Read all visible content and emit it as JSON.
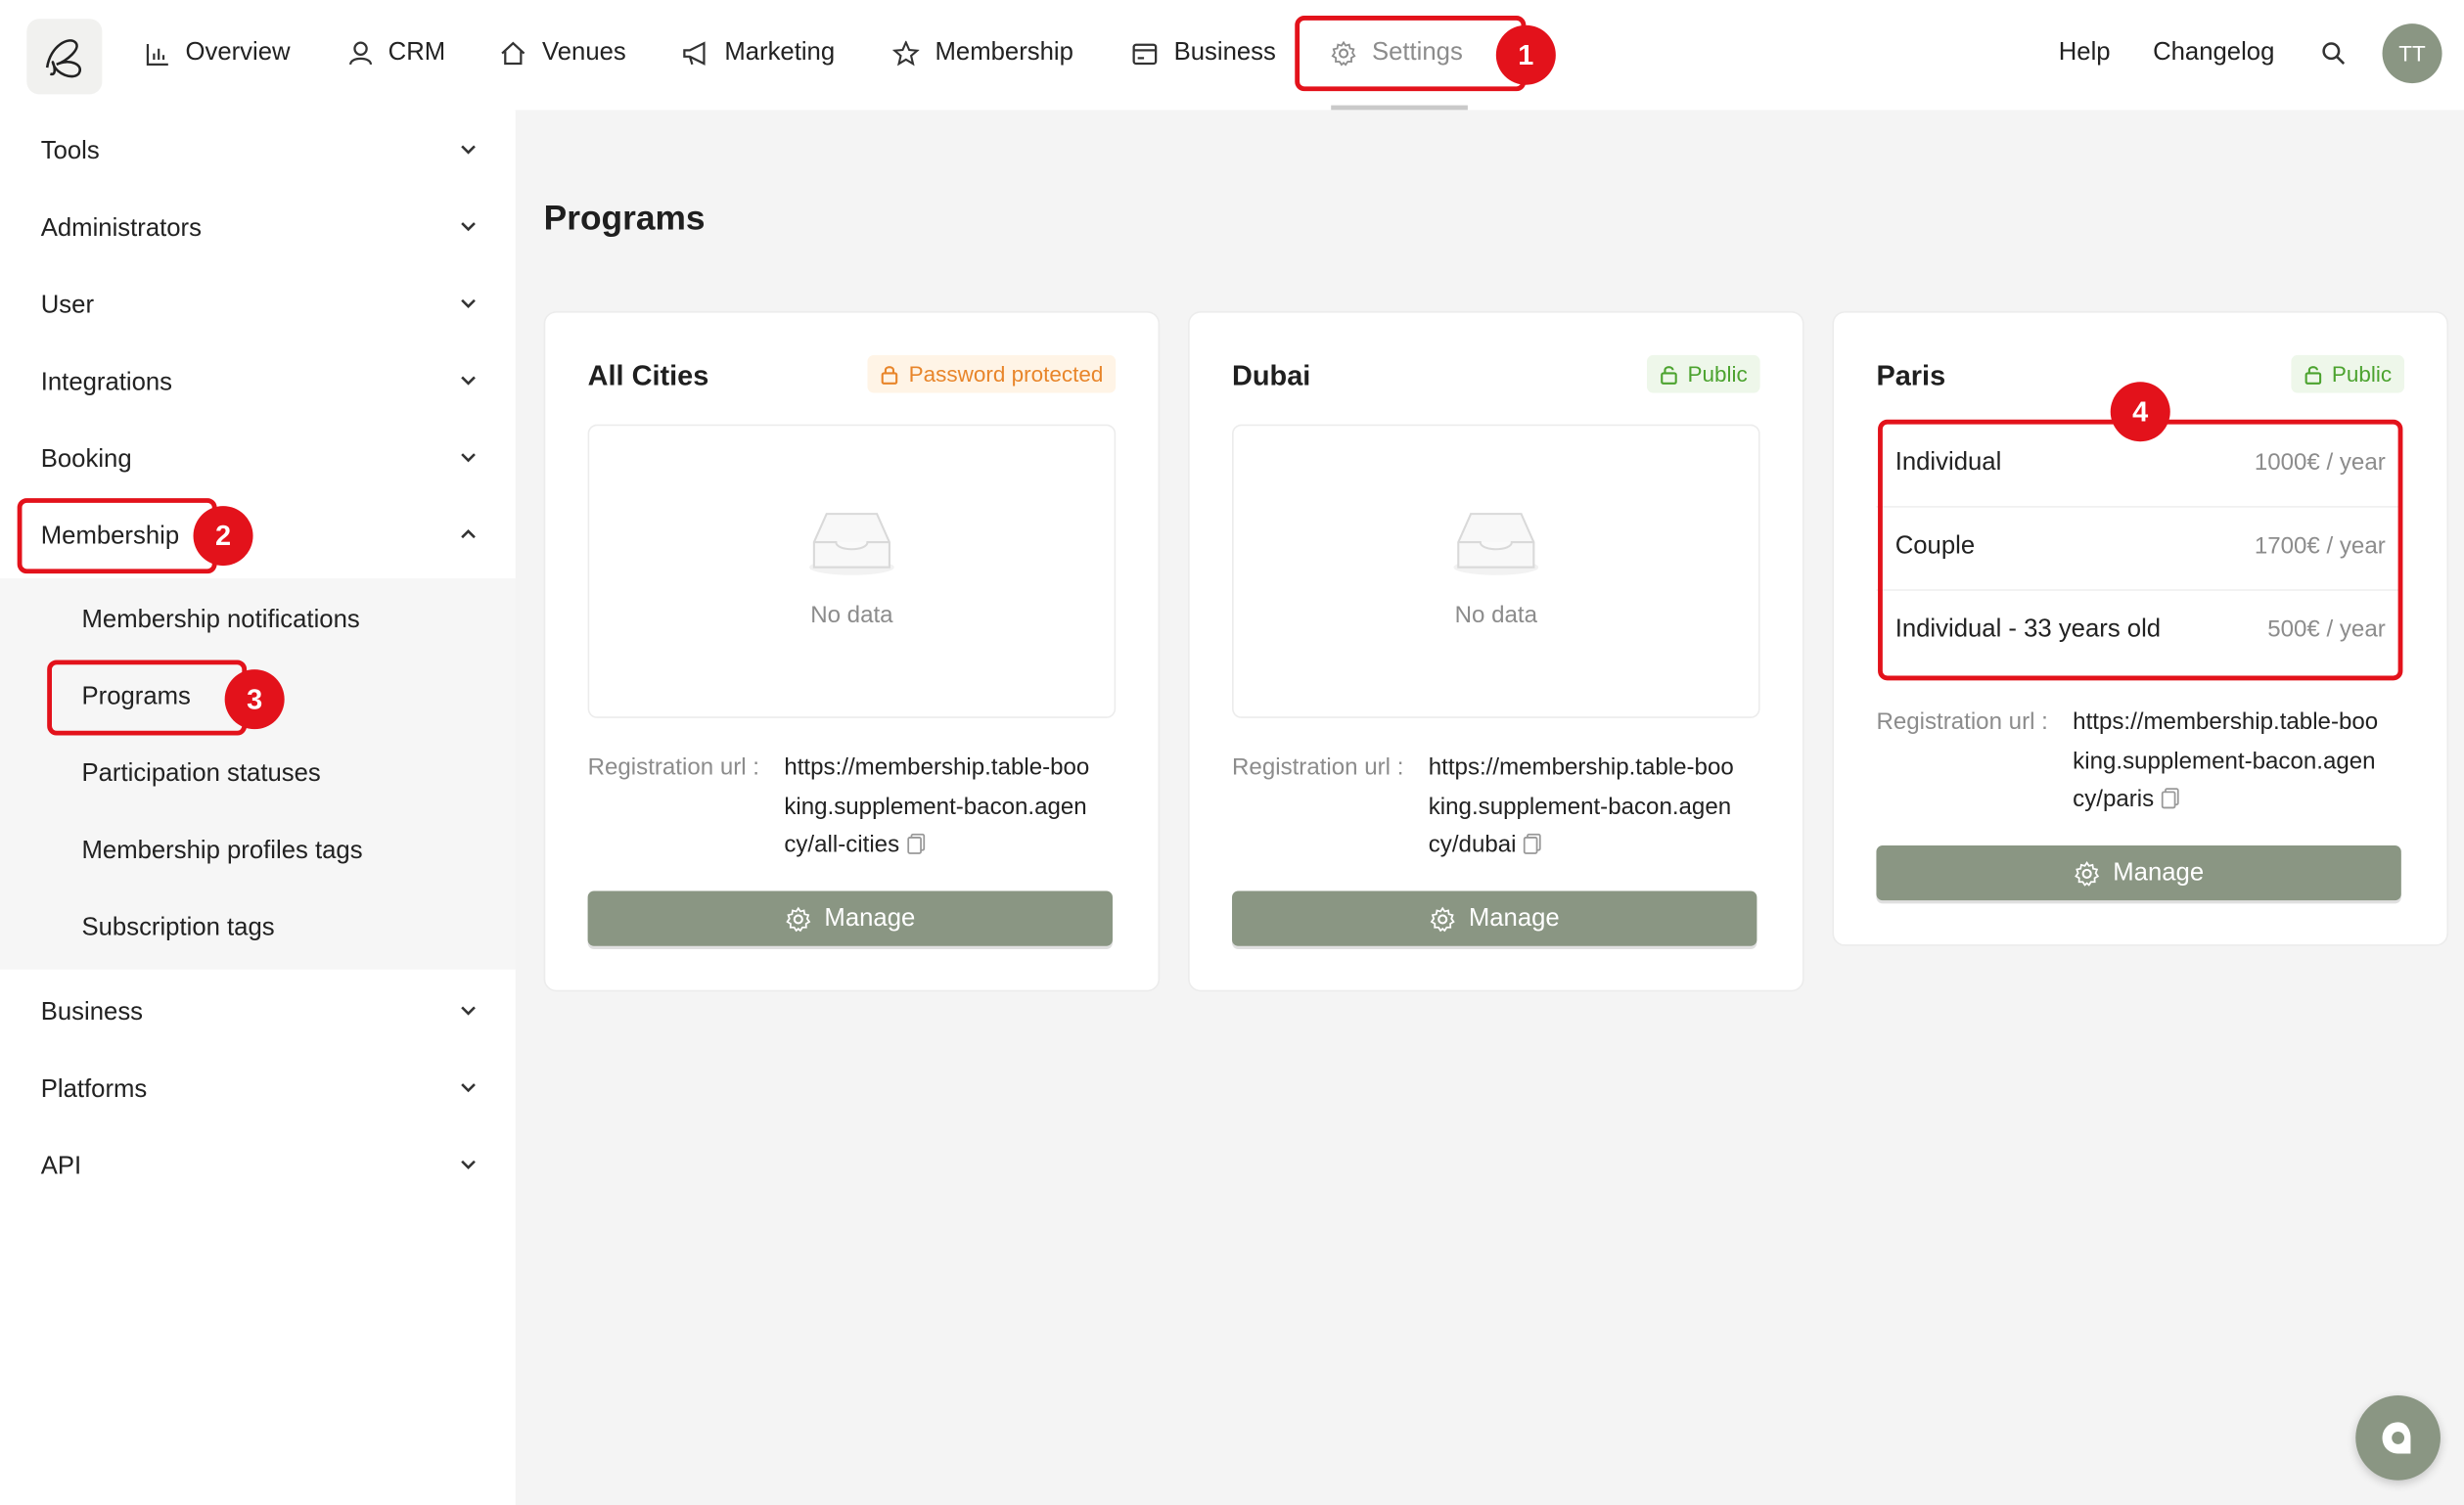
{
  "nav": {
    "items": [
      {
        "label": "Overview",
        "icon": "bar-chart-icon"
      },
      {
        "label": "CRM",
        "icon": "user-icon"
      },
      {
        "label": "Venues",
        "icon": "home-icon"
      },
      {
        "label": "Marketing",
        "icon": "megaphone-icon"
      },
      {
        "label": "Membership",
        "icon": "star-icon"
      },
      {
        "label": "Business",
        "icon": "wallet-icon"
      },
      {
        "label": "Settings",
        "icon": "gear-icon"
      }
    ],
    "active": "Settings",
    "help": "Help",
    "changelog": "Changelog",
    "avatar": "TT"
  },
  "sidebar": {
    "items": [
      {
        "label": "Tools"
      },
      {
        "label": "Administrators"
      },
      {
        "label": "User"
      },
      {
        "label": "Integrations"
      },
      {
        "label": "Booking"
      },
      {
        "label": "Membership"
      },
      {
        "label": "Business"
      },
      {
        "label": "Platforms"
      },
      {
        "label": "API"
      }
    ],
    "membership_sub": [
      {
        "label": "Membership notifications"
      },
      {
        "label": "Programs"
      },
      {
        "label": "Participation statuses"
      },
      {
        "label": "Membership profiles tags"
      },
      {
        "label": "Subscription tags"
      }
    ]
  },
  "main": {
    "title": "Programs",
    "cards": [
      {
        "title": "All Cities",
        "badge": "Password protected",
        "empty": "No data",
        "reg_label": "Registration url :",
        "reg_url": "https://membership.table-booking.supplement-bacon.agency/all-cities",
        "manage": "Manage"
      },
      {
        "title": "Dubai",
        "badge": "Public",
        "empty": "No data",
        "reg_label": "Registration url :",
        "reg_url": "https://membership.table-booking.supplement-bacon.agency/dubai",
        "manage": "Manage"
      },
      {
        "title": "Paris",
        "badge": "Public",
        "reg_label": "Registration url :",
        "reg_url": "https://membership.table-booking.supplement-bacon.agency/paris",
        "manage": "Manage",
        "programs": [
          {
            "name": "Individual",
            "price": "1000€ / year"
          },
          {
            "name": "Couple",
            "price": "1700€ / year"
          },
          {
            "name": "Individual - 33 years old",
            "price": "500€ / year"
          }
        ]
      }
    ]
  },
  "annotations": [
    "1",
    "2",
    "3",
    "4"
  ],
  "colors": {
    "accent": "#8a9683",
    "annotation": "#e3121b",
    "badge_warn": "#e8852a",
    "badge_public": "#4ca32f"
  }
}
